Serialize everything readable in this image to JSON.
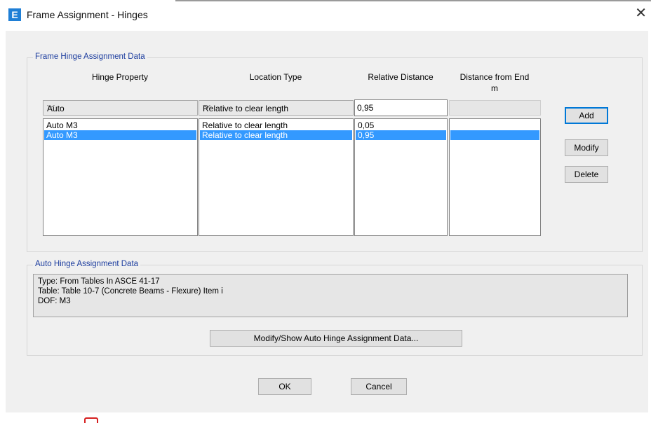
{
  "window": {
    "title": "Frame Assignment - Hinges",
    "app_icon_letter": "E"
  },
  "frame_hinge_group": {
    "label": "Frame Hinge Assignment Data",
    "columns": [
      "Hinge Property",
      "Location Type",
      "Relative Distance",
      "Distance from End"
    ],
    "distance_unit": "m",
    "inputs": {
      "hinge_property": "Auto",
      "location_type": "Relative to clear length",
      "relative_distance": "0,95"
    },
    "rows": [
      {
        "hinge_property": "Auto  M3",
        "location_type": "Relative to clear length",
        "relative_distance": "0,05",
        "distance_from_end": ""
      },
      {
        "hinge_property": "Auto  M3",
        "location_type": "Relative to clear length",
        "relative_distance": "0,95",
        "distance_from_end": ""
      }
    ],
    "selected_row": 1,
    "buttons": {
      "add": "Add",
      "modify": "Modify",
      "delete": "Delete"
    }
  },
  "auto_hinge_group": {
    "label": "Auto Hinge Assignment Data",
    "lines": [
      "Type:  From Tables In ASCE 41-17",
      "Table:  Table 10-7 (Concrete Beams - Flexure) Item i",
      "DOF:  M3"
    ],
    "button": "Modify/Show Auto Hinge Assignment Data..."
  },
  "footer": {
    "ok": "OK",
    "cancel": "Cancel"
  },
  "colors": {
    "selection": "#3399ff",
    "group_label": "#1b3c9e",
    "accent": "#0078d7"
  }
}
